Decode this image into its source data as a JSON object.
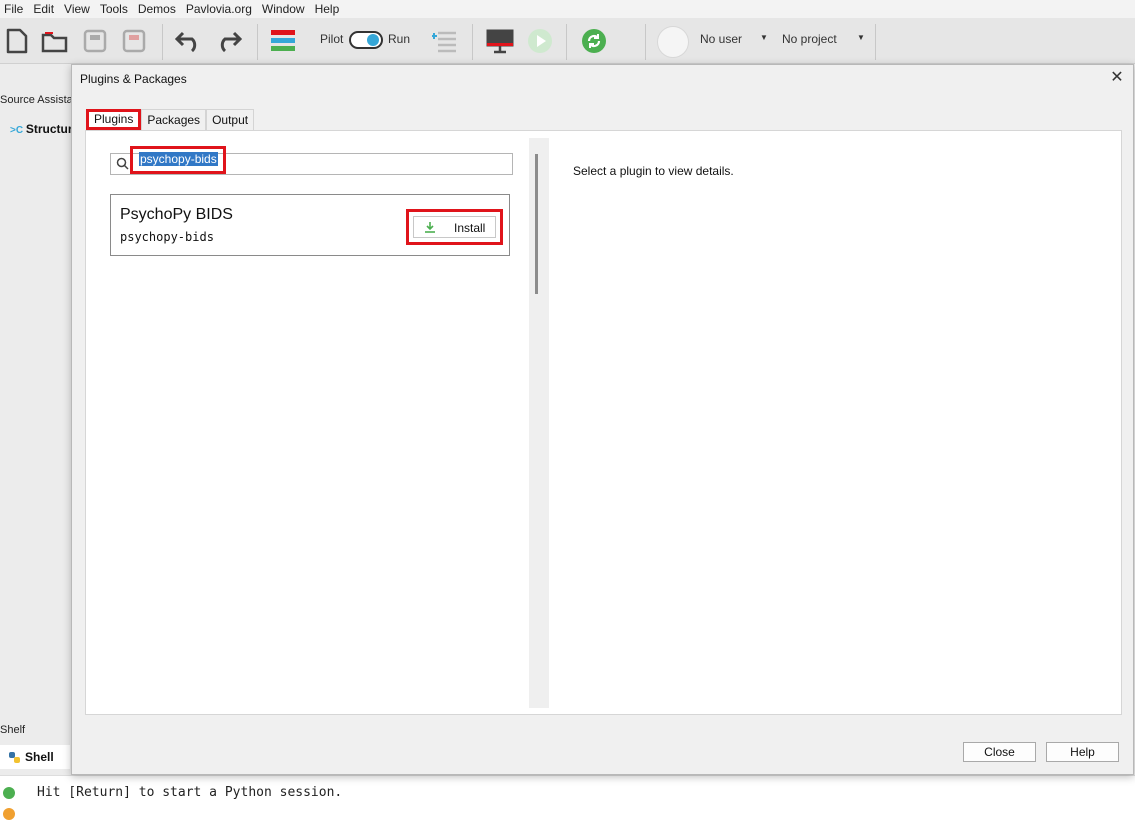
{
  "menubar": [
    "File",
    "Edit",
    "View",
    "Tools",
    "Demos",
    "Pavlovia.org",
    "Window",
    "Help"
  ],
  "toolbar": {
    "pilot_label": "Pilot",
    "run_label": "Run",
    "user_label": "No user",
    "project_label": "No project",
    "icons": [
      "new-file-icon",
      "open-folder-icon",
      "save-icon",
      "save-as-icon",
      "undo-icon",
      "redo-icon",
      "monitor-center-icon",
      "pilot-run-toggle",
      "send-to-runner-icon",
      "monitor-icon",
      "run-icon",
      "sync-icon",
      "user-avatar-icon"
    ]
  },
  "background": {
    "source_tab": "Source Assista",
    "structure_label": "Structur",
    "shelf_label": "Shelf",
    "shell_tab": "Shell",
    "shell_message": "Hit [Return] to start a Python session."
  },
  "dialog": {
    "title": "Plugins & Packages",
    "tabs": [
      "Plugins",
      "Packages",
      "Output"
    ],
    "active_tab": "Plugins",
    "search_value": "psychopy-bids",
    "plugins": [
      {
        "name": "PsychoPy BIDS",
        "package": "psychopy-bids",
        "action": "Install"
      }
    ],
    "details_placeholder": "Select a plugin to view details.",
    "close_button": "Close",
    "help_button": "Help"
  },
  "colors": {
    "highlight": "#e0141b",
    "selection": "#3178c6",
    "install_icon": "#4caf50"
  }
}
